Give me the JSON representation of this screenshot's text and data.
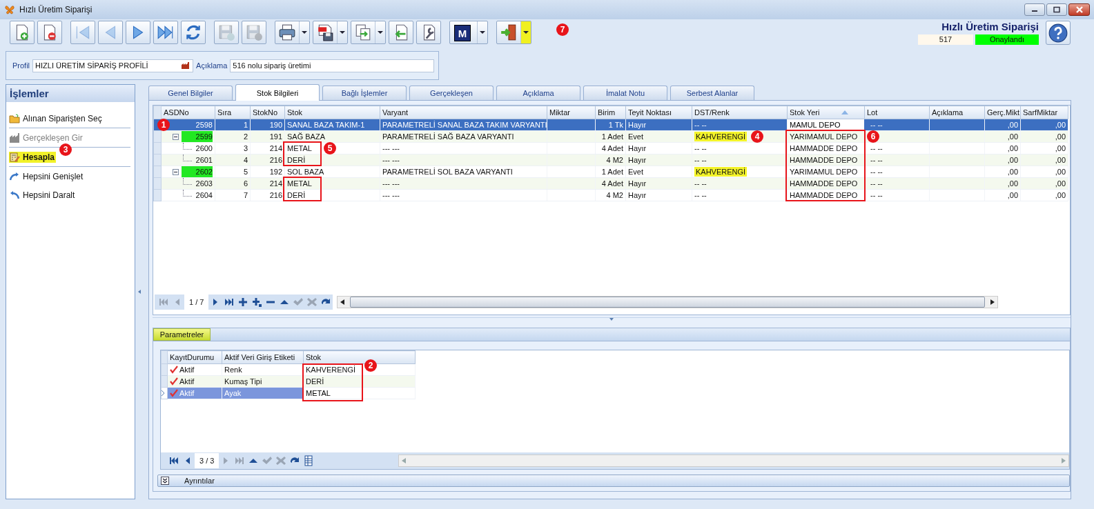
{
  "window": {
    "title": "Hızlı Üretim Siparişi"
  },
  "toolbar": [
    {
      "kind": "new",
      "disabled": false,
      "dropdown": false
    },
    {
      "kind": "delete",
      "disabled": false,
      "dropdown": false
    },
    {
      "kind": "first",
      "disabled": true,
      "dropdown": false
    },
    {
      "kind": "prev",
      "disabled": true,
      "dropdown": false
    },
    {
      "kind": "next",
      "disabled": false,
      "dropdown": false
    },
    {
      "kind": "last",
      "disabled": false,
      "dropdown": false
    },
    {
      "kind": "refresh",
      "disabled": false,
      "dropdown": false
    },
    {
      "kind": "save",
      "disabled": true,
      "dropdown": false
    },
    {
      "kind": "save-cancel",
      "disabled": true,
      "dropdown": false
    },
    {
      "kind": "print",
      "disabled": false,
      "dropdown": true
    },
    {
      "kind": "pdf",
      "disabled": false,
      "dropdown": true
    },
    {
      "kind": "copy",
      "disabled": false,
      "dropdown": true
    },
    {
      "kind": "import",
      "disabled": false,
      "dropdown": false
    },
    {
      "kind": "tools",
      "disabled": false,
      "dropdown": false
    },
    {
      "kind": "letter",
      "letter": "M",
      "disabled": false,
      "dropdown": true
    },
    {
      "kind": "exit",
      "disabled": false,
      "dropdown": true,
      "dropdown_highlight": true
    }
  ],
  "header": {
    "title": "Hızlı Üretim Siparişi",
    "number": "517",
    "status": "Onaylandı"
  },
  "profile": {
    "label": "Profil",
    "value": "HIZLI ÜRETİM SİPARİŞ PROFİLİ",
    "description_label": "Açıklama",
    "description": "516 nolu sipariş üretimi"
  },
  "sidebar": {
    "title": "İşlemler",
    "items": [
      {
        "label": "Alınan Siparişten Seç",
        "disabled": false,
        "highlighted": false
      },
      {
        "label": "Gerçekleşen Gir",
        "disabled": true,
        "highlighted": false
      },
      {
        "label": "Hesapla",
        "disabled": false,
        "highlighted": true
      },
      {
        "label": "Hepsini Genişlet",
        "disabled": false,
        "highlighted": false
      },
      {
        "label": "Hepsini Daralt",
        "disabled": false,
        "highlighted": false
      }
    ]
  },
  "tabs": [
    {
      "label": "Genel Bilgiler",
      "selected": false
    },
    {
      "label": "Stok Bilgileri",
      "selected": true
    },
    {
      "label": "Bağlı İşlemler",
      "selected": false
    },
    {
      "label": "Gerçekleşen",
      "selected": false
    },
    {
      "label": "Açıklama",
      "selected": false
    },
    {
      "label": "İmalat Notu",
      "selected": false
    },
    {
      "label": "Serbest Alanlar",
      "selected": false
    }
  ],
  "grid": {
    "columns": [
      "ASDNo",
      "Sıra",
      "StokNo",
      "Stok",
      "Varyant",
      "Miktar",
      "Birim",
      "Teyit Noktası",
      "DST/Renk",
      "Stok Yeri",
      "Lot",
      "Açıklama",
      "Gerç.Mikt",
      "SarfMiktar"
    ],
    "rows": [
      {
        "asd": "2598",
        "sira": "1",
        "stokno": "190",
        "stok": "SANAL BAZA TAKIM-1",
        "varyant": "PARAMETRELİ SANAL BAZA TAKIM VARYANTI",
        "birim": "1 Tk",
        "teyit": "Hayır",
        "dst": "-- --",
        "stok_yeri": "MAMUL DEPO",
        "lot": "-- --",
        "gerc": ",00",
        "sarf": ",00",
        "selected": true,
        "asd_highlight": false,
        "dst_highlight": false,
        "children": [
          {
            "asd": "2599",
            "sira": "2",
            "stokno": "191",
            "stok": "SAĞ BAZA",
            "varyant": "PARAMETRELİ SAĞ BAZA VARYANTI",
            "birim": "1 Adet",
            "teyit": "Evet",
            "dst": "KAHVERENGİ",
            "stok_yeri": "YARIMAMUL DEPO",
            "gerc": ",00",
            "sarf": ",00",
            "selected": false,
            "asd_highlight": true,
            "dst_highlight": true,
            "expanded": true,
            "children": [
              {
                "asd": "2600",
                "sira": "3",
                "stokno": "214",
                "stok": "METAL",
                "varyant": "--- ---",
                "birim": "4 Adet",
                "teyit": "Hayır",
                "dst": "-- --",
                "stok_yeri": "HAMMADDE DEPO",
                "lot": "-- --",
                "gerc": ",00",
                "sarf": ",00",
                "selected": false,
                "asd_highlight": false,
                "dst_highlight": false
              },
              {
                "asd": "2601",
                "sira": "4",
                "stokno": "216",
                "stok": "DERİ",
                "varyant": "--- ---",
                "birim": "4 M2",
                "teyit": "Hayır",
                "dst": "-- --",
                "stok_yeri": "HAMMADDE DEPO",
                "lot": "-- --",
                "gerc": ",00",
                "sarf": ",00",
                "selected": false,
                "asd_highlight": false,
                "dst_highlight": false
              }
            ]
          },
          {
            "asd": "2602",
            "sira": "5",
            "stokno": "192",
            "stok": "SOL BAZA",
            "varyant": "PARAMETRELİ SOL BAZA VARYANTI",
            "birim": "1 Adet",
            "teyit": "Evet",
            "dst": "KAHVERENGİ",
            "stok_yeri": "YARIMAMUL DEPO",
            "lot": "-- --",
            "gerc": ",00",
            "sarf": ",00",
            "selected": false,
            "asd_highlight": true,
            "dst_highlight": true,
            "expanded": true,
            "children": [
              {
                "asd": "2603",
                "sira": "6",
                "stokno": "214",
                "stok": "METAL",
                "varyant": "--- ---",
                "birim": "4 Adet",
                "teyit": "Hayır",
                "dst": "-- --",
                "stok_yeri": "HAMMADDE DEPO",
                "lot": "-- --",
                "gerc": ",00",
                "sarf": ",00",
                "selected": false,
                "asd_highlight": false,
                "dst_highlight": false
              },
              {
                "asd": "2604",
                "sira": "7",
                "stokno": "216",
                "stok": "DERİ",
                "varyant": "--- ---",
                "birim": "4 M2",
                "teyit": "Hayır",
                "dst": "-- --",
                "stok_yeri": "HAMMADDE DEPO",
                "lot": "-- --",
                "gerc": ",00",
                "sarf": ",00",
                "selected": false,
                "asd_highlight": false,
                "dst_highlight": false
              }
            ]
          }
        ]
      }
    ],
    "navigator": {
      "position": "1 / 7",
      "buttons": [
        {
          "kind": "first",
          "disabled": true
        },
        {
          "kind": "prev",
          "disabled": true
        },
        {
          "kind": "next",
          "disabled": false
        },
        {
          "kind": "last",
          "disabled": false
        },
        {
          "kind": "add",
          "disabled": false
        },
        {
          "kind": "add-child",
          "disabled": false
        },
        {
          "kind": "remove",
          "disabled": false
        },
        {
          "kind": "up",
          "disabled": false
        },
        {
          "kind": "check",
          "disabled": true
        },
        {
          "kind": "cancel",
          "disabled": true
        },
        {
          "kind": "redo",
          "disabled": false
        }
      ]
    }
  },
  "parameters": {
    "tab": "Parametreler",
    "columns": [
      "KayıtDurumu",
      "Aktif Veri Giriş Etiketi",
      "Stok"
    ],
    "rows": [
      {
        "status": "Aktif",
        "label": "Renk",
        "stok": "KAHVERENGİ",
        "selected": false
      },
      {
        "status": "Aktif",
        "label": "Kumaş Tipi",
        "stok": "DERİ",
        "selected": false
      },
      {
        "status": "Aktif",
        "label": "Ayak",
        "stok": "METAL",
        "selected": true
      }
    ],
    "navigator": {
      "position": "3 / 3",
      "buttons": [
        {
          "kind": "first",
          "disabled": false
        },
        {
          "kind": "prev",
          "disabled": false
        },
        {
          "kind": "next",
          "disabled": true
        },
        {
          "kind": "last",
          "disabled": true
        },
        {
          "kind": "up",
          "disabled": false
        },
        {
          "kind": "check",
          "disabled": true
        },
        {
          "kind": "cancel",
          "disabled": true
        },
        {
          "kind": "redo",
          "disabled": false
        },
        {
          "kind": "columns",
          "disabled": false
        }
      ]
    },
    "details": "Ayrıntılar"
  },
  "callouts": [
    {
      "number": "1"
    },
    {
      "number": "2"
    },
    {
      "number": "3"
    },
    {
      "number": "4"
    },
    {
      "number": "5"
    },
    {
      "number": "6"
    },
    {
      "number": "7"
    }
  ]
}
